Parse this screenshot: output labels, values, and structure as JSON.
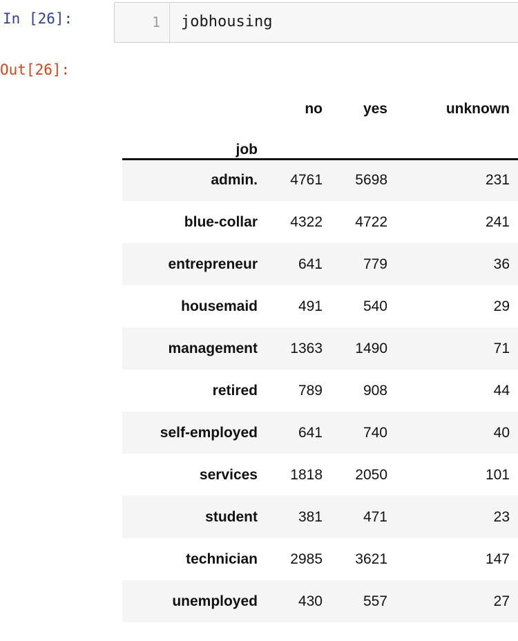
{
  "notebook": {
    "input_prompt": "In [26]:",
    "output_prompt": "Out[26]:",
    "line_number": "1",
    "code": "jobhousing",
    "prompt_in_color": "#303F9F",
    "prompt_out_color": "#D84315"
  },
  "table": {
    "index_name": "job",
    "columns": [
      "no",
      "yes",
      "unknown"
    ],
    "rows": [
      {
        "job": "admin.",
        "no": "4761",
        "yes": "5698",
        "unknown": "231"
      },
      {
        "job": "blue-collar",
        "no": "4322",
        "yes": "4722",
        "unknown": "241"
      },
      {
        "job": "entrepreneur",
        "no": "641",
        "yes": "779",
        "unknown": "36"
      },
      {
        "job": "housemaid",
        "no": "491",
        "yes": "540",
        "unknown": "29"
      },
      {
        "job": "management",
        "no": "1363",
        "yes": "1490",
        "unknown": "71"
      },
      {
        "job": "retired",
        "no": "789",
        "yes": "908",
        "unknown": "44"
      },
      {
        "job": "self-employed",
        "no": "641",
        "yes": "740",
        "unknown": "40"
      },
      {
        "job": "services",
        "no": "1818",
        "yes": "2050",
        "unknown": "101"
      },
      {
        "job": "student",
        "no": "381",
        "yes": "471",
        "unknown": "23"
      },
      {
        "job": "technician",
        "no": "2985",
        "yes": "3621",
        "unknown": "147"
      },
      {
        "job": "unemployed",
        "no": "430",
        "yes": "557",
        "unknown": "27"
      }
    ]
  }
}
